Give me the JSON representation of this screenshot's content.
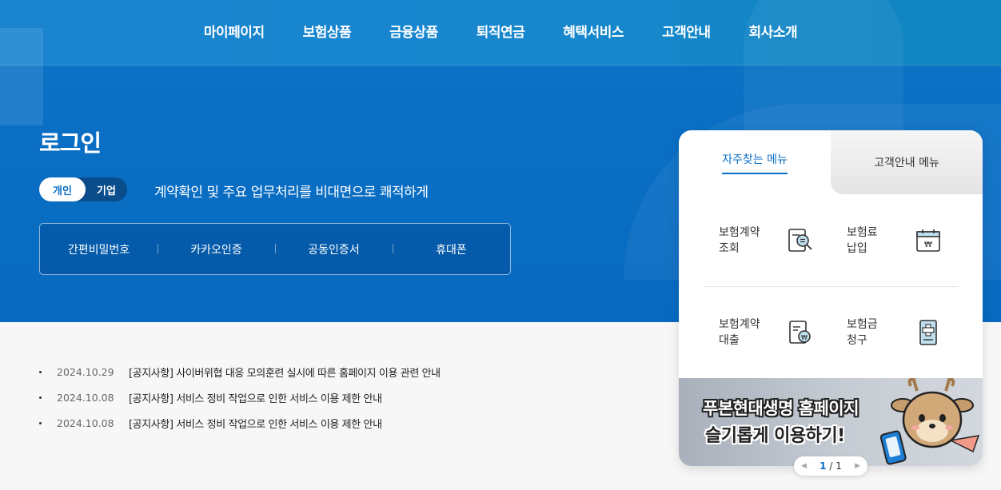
{
  "nav": [
    "마이페이지",
    "보험상품",
    "금융상품",
    "퇴직연금",
    "혜택서비스",
    "고객안내",
    "회사소개"
  ],
  "page_title": "로그인",
  "toggle": {
    "personal": "개인",
    "corporate": "기업"
  },
  "tagline": "계약확인 및 주요 업무처리를 비대면으로 쾌적하게",
  "auth_methods": [
    "간편비밀번호",
    "카카오인증",
    "공동인증서",
    "휴대폰"
  ],
  "notices": [
    {
      "date": "2024.10.29",
      "text": "[공지사항] 사이버위협 대응 모의훈련 실시에 따른 홈페이지 이용 관련 안내"
    },
    {
      "date": "2024.10.08",
      "text": "[공지사항] 서비스 정비 작업으로 인한 서비스 이용 제한 안내"
    },
    {
      "date": "2024.10.08",
      "text": "[공지사항] 서비스 정비 작업으로 인한 서비스 이용 제한 안내"
    }
  ],
  "panel": {
    "tab_active": "자주찾는 메뉴",
    "tab_inactive": "고객안내 메뉴",
    "menu": [
      {
        "line1": "보험계약",
        "line2": "조회",
        "icon": "contract-search-icon"
      },
      {
        "line1": "보험료",
        "line2": "납입",
        "icon": "payment-calendar-icon"
      },
      {
        "line1": "보험계약",
        "line2": "대출",
        "icon": "contract-loan-icon"
      },
      {
        "line1": "보험금",
        "line2": "청구",
        "icon": "claim-icon"
      }
    ],
    "banner": {
      "line1": "푸본현대생명 홈페이지",
      "line2": "슬기롭게 이용하기!"
    },
    "pager": {
      "current": "1",
      "sep": " / ",
      "total": "1"
    }
  },
  "colors": {
    "primary": "#0a6fc4",
    "hero_dark": "#0b4d8a"
  }
}
